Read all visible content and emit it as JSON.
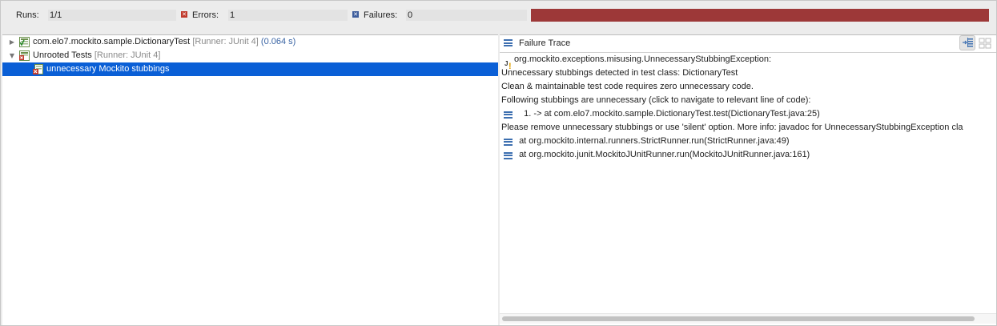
{
  "counters": {
    "runs_label": "Runs:",
    "runs_value": "1/1",
    "errors_label": "Errors:",
    "errors_value": "1",
    "failures_label": "Failures:",
    "failures_value": "0",
    "status_color": "#9d3838"
  },
  "tree": {
    "rows": [
      {
        "name": "com.elo7.mockito.sample.DictionaryTest",
        "runner": "[Runner: JUnit 4]",
        "time": "(0.064 s)",
        "expanded": false,
        "icon": "test-suite-ok-icon"
      },
      {
        "name": "Unrooted Tests",
        "runner": "[Runner: JUnit 4]",
        "expanded": true,
        "icon": "test-suite-error-icon"
      },
      {
        "name": "unnecessary Mockito stubbings",
        "selected": true,
        "icon": "test-error-icon"
      }
    ]
  },
  "trace": {
    "title": "Failure Trace",
    "lines": [
      {
        "icon": "java-exception-icon",
        "text": "org.mockito.exceptions.misusing.UnnecessaryStubbingException:"
      },
      {
        "icon": "",
        "text": "Unnecessary stubbings detected in test class: DictionaryTest"
      },
      {
        "icon": "",
        "text": "Clean & maintainable test code requires zero unnecessary code."
      },
      {
        "icon": "",
        "text": "Following stubbings are unnecessary (click to navigate to relevant line of code):"
      },
      {
        "icon": "stack-frame-icon",
        "text": "  1. -> at com.elo7.mockito.sample.DictionaryTest.test(DictionaryTest.java:25)"
      },
      {
        "icon": "",
        "text": "Please remove unnecessary stubbings or use 'silent' option. More info: javadoc for UnnecessaryStubbingException cla"
      },
      {
        "icon": "stack-frame-icon",
        "text": "at org.mockito.internal.runners.StrictRunner.run(StrictRunner.java:49)"
      },
      {
        "icon": "stack-frame-icon",
        "text": "at org.mockito.junit.MockitoJUnitRunner.run(MockitoJUnitRunner.java:161)"
      }
    ]
  },
  "colors": {
    "selection": "#0a5fd6",
    "error_bar": "#9d3838",
    "icon_blue": "#3d6fb0"
  }
}
